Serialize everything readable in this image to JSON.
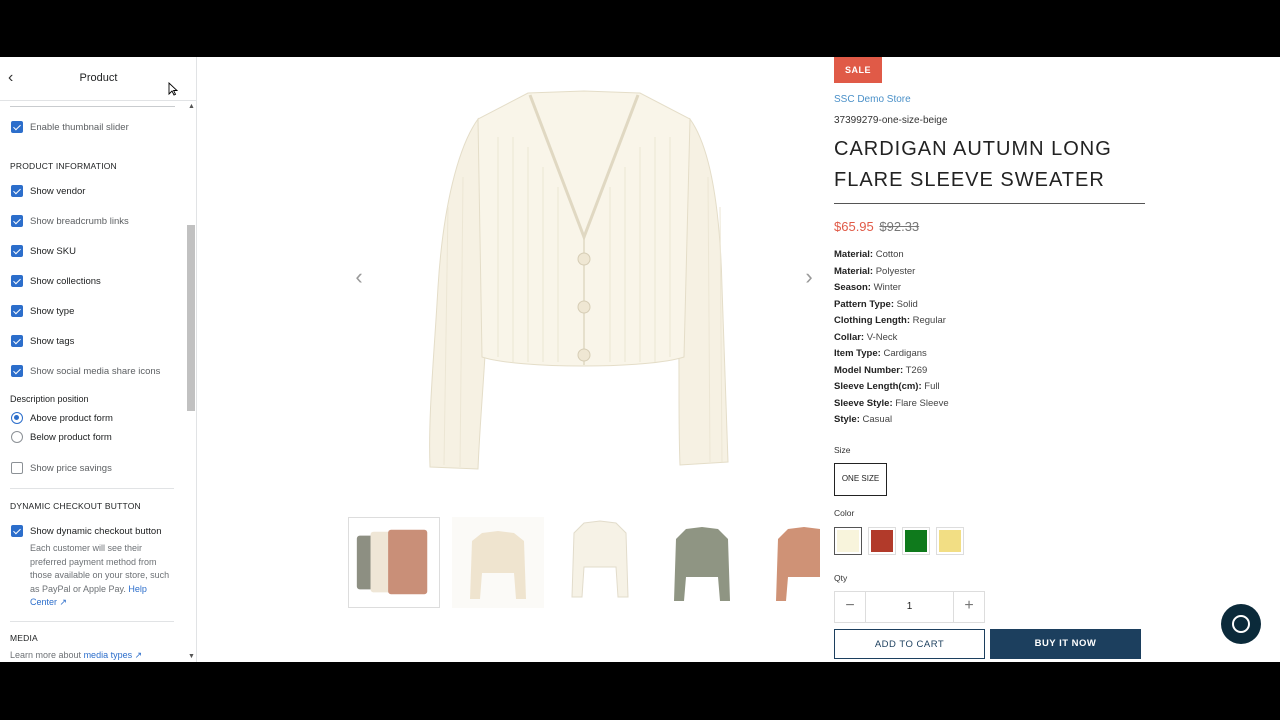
{
  "sidebar": {
    "title": "Product",
    "thumbnail_slider": "Enable thumbnail slider",
    "product_info_heading": "PRODUCT INFORMATION",
    "options": [
      {
        "label": "Show vendor",
        "checked": true
      },
      {
        "label": "Show breadcrumb links",
        "checked": true
      },
      {
        "label": "Show SKU",
        "checked": true
      },
      {
        "label": "Show collections",
        "checked": true
      },
      {
        "label": "Show type",
        "checked": true
      },
      {
        "label": "Show tags",
        "checked": true
      },
      {
        "label": "Show social media share icons",
        "checked": true
      }
    ],
    "desc_position_label": "Description position",
    "desc_positions": [
      {
        "label": "Above product form",
        "selected": true
      },
      {
        "label": "Below product form",
        "selected": false
      }
    ],
    "price_savings": "Show price savings",
    "dynamic_checkout_heading": "DYNAMIC CHECKOUT BUTTON",
    "dynamic_checkout_label": "Show dynamic checkout button",
    "dynamic_checkout_help": "Each customer will see their preferred payment method from those available on your store, such as PayPal or Apple Pay.",
    "help_center": "Help Center",
    "media_heading": "MEDIA",
    "learn_more_prefix": "Learn more about",
    "media_types_link": "media types"
  },
  "product": {
    "badge": "SALE",
    "vendor": "SSC Demo Store",
    "sku": "37399279-one-size-beige",
    "title": "CARDIGAN AUTUMN LONG FLARE SLEEVE SWEATER",
    "price": "$65.95",
    "compare_price": "$92.33",
    "specs": [
      {
        "k": "Material:",
        "v": "Cotton"
      },
      {
        "k": "Material:",
        "v": "Polyester"
      },
      {
        "k": "Season:",
        "v": "Winter"
      },
      {
        "k": "Pattern Type:",
        "v": "Solid"
      },
      {
        "k": "Clothing Length:",
        "v": "Regular"
      },
      {
        "k": "Collar:",
        "v": "V-Neck"
      },
      {
        "k": "Item Type:",
        "v": "Cardigans"
      },
      {
        "k": "Model Number:",
        "v": "T269"
      },
      {
        "k": "Sleeve Length(cm):",
        "v": "Full"
      },
      {
        "k": "Sleeve Style:",
        "v": "Flare Sleeve"
      },
      {
        "k": "Style:",
        "v": "Casual"
      }
    ],
    "size_label": "Size",
    "size_value": "ONE SIZE",
    "color_label": "Color",
    "colors": [
      "#f8f4dc",
      "#b23a2a",
      "#0f7a1c",
      "#f2de84"
    ],
    "qty_label": "Qty",
    "qty_value": "1",
    "add_to_cart": "ADD TO CART",
    "buy_now": "BUY IT NOW"
  },
  "colors": {
    "accent": "#2c6ecb",
    "sale": "#e05a47",
    "primary_button": "#1c3f5e"
  },
  "icons": [
    "back-arrow-icon",
    "external-link-icon",
    "chevron-left-icon",
    "chevron-right-icon",
    "chat-icon"
  ]
}
